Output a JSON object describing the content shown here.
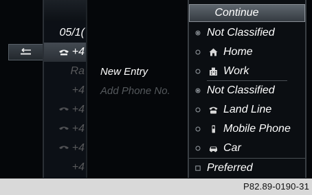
{
  "call_list": {
    "header_text": "05/1(",
    "rows": [
      {
        "text": "+4"
      },
      {
        "text": "Ra"
      },
      {
        "text": "+4"
      },
      {
        "text": "+4"
      },
      {
        "text": "+4"
      },
      {
        "text": "+4"
      },
      {
        "text": "+4"
      }
    ]
  },
  "submenu": {
    "new_entry": "New Entry",
    "add_phone": "Add Phone No."
  },
  "menu": {
    "continue": "Continue",
    "items": [
      {
        "label": "Not Classified",
        "bullet": "filled-circle",
        "icon": ""
      },
      {
        "label": "Home",
        "bullet": "empty-circle",
        "icon": "house-icon"
      },
      {
        "label": "Work",
        "bullet": "empty-circle",
        "icon": "building-icon"
      },
      {
        "label": "Not Classified",
        "bullet": "filled-circle",
        "icon": ""
      },
      {
        "label": "Land Line",
        "bullet": "empty-circle",
        "icon": "landline-phone-icon"
      },
      {
        "label": "Mobile Phone",
        "bullet": "empty-circle",
        "icon": "mobile-phone-icon"
      },
      {
        "label": "Car",
        "bullet": "empty-circle",
        "icon": "car-icon"
      },
      {
        "label": "Preferred",
        "bullet": "empty-checkbox",
        "icon": ""
      }
    ]
  },
  "caption": "P82.89-0190-31"
}
